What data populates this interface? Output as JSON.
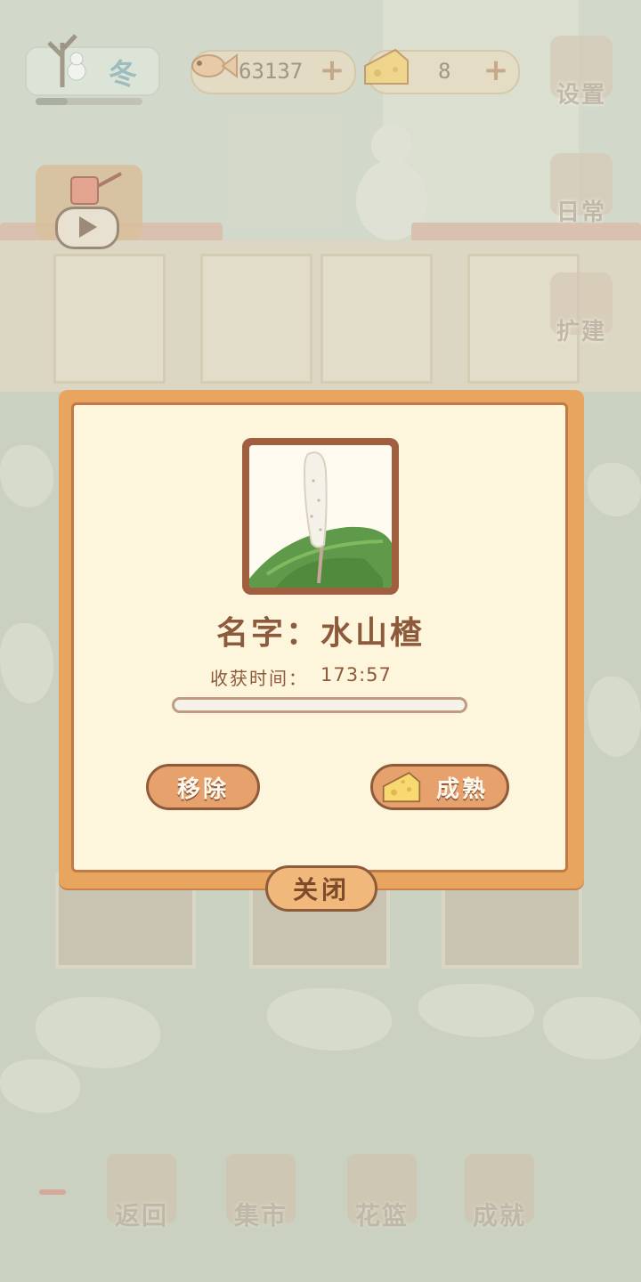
{
  "top_bar": {
    "season_label": "冬",
    "season_progress": 0.3,
    "fish_count": "63137",
    "cheese_count": "8",
    "fish_icon": "fish-bone-icon",
    "cheese_icon": "cheese-icon",
    "plus_symbol": "+"
  },
  "side_menu": [
    {
      "label": "设置",
      "icon": "gear-icon"
    },
    {
      "label": "日常",
      "icon": "checklist-icon"
    },
    {
      "label": "扩建",
      "icon": "hammer-icon"
    }
  ],
  "water_button": {
    "icon": "watering-can-icon",
    "play_icon": "play-icon"
  },
  "dialog": {
    "plant_icon": "water-hawthorn-plant",
    "name_text": "名字：水山楂",
    "harvest_label": "收获时间：",
    "harvest_time": "173:57",
    "growth_progress": 0.0,
    "remove_label": "移除",
    "ripen_label": "成熟",
    "close_label": "关闭"
  },
  "bottom_nav": [
    {
      "label": "返回",
      "icon": "window-icon"
    },
    {
      "label": "集市",
      "icon": "market-stall-icon"
    },
    {
      "label": "花篮",
      "icon": "flower-basket-icon"
    },
    {
      "label": "成就",
      "icon": "trophy-icon"
    }
  ],
  "colors": {
    "dialog_border": "#e8a560",
    "dialog_bg": "#fdf5dc",
    "text_brown": "#8d5a3b",
    "button_fill": "#e6a16c"
  }
}
